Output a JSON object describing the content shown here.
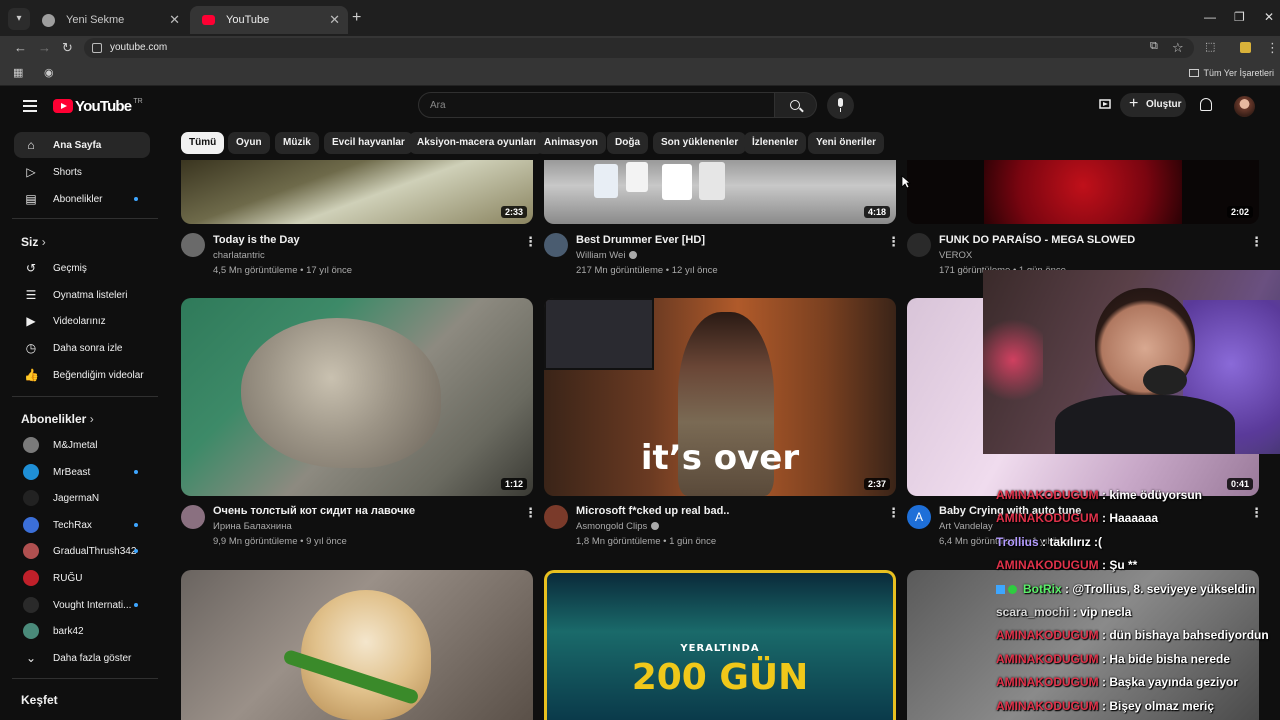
{
  "browser": {
    "tabs": [
      {
        "title": "Yeni Sekme"
      },
      {
        "title": "YouTube"
      }
    ],
    "url": "youtube.com",
    "bookmarks_folder": "Tüm Yer İşaretleri"
  },
  "header": {
    "logo_text": "YouTube",
    "country_code": "TR",
    "search_placeholder": "Ara",
    "create_label": "Oluştur"
  },
  "sidebar": {
    "main": [
      {
        "label": "Ana Sayfa",
        "icon": "home-icon",
        "active": true
      },
      {
        "label": "Shorts",
        "icon": "shorts-icon"
      },
      {
        "label": "Abonelikler",
        "icon": "subscriptions-icon",
        "dot": true
      }
    ],
    "you_header": "Siz",
    "you": [
      {
        "label": "Geçmiş",
        "icon": "history-icon"
      },
      {
        "label": "Oynatma listeleri",
        "icon": "playlists-icon"
      },
      {
        "label": "Videolarınız",
        "icon": "your-videos-icon"
      },
      {
        "label": "Daha sonra izle",
        "icon": "watch-later-icon"
      },
      {
        "label": "Beğendiğim videolar",
        "icon": "liked-videos-icon"
      }
    ],
    "subs_header": "Abonelikler",
    "subscriptions": [
      {
        "label": "M&Jmetal",
        "color": "#7a7a7a"
      },
      {
        "label": "MrBeast",
        "color": "#1f8fd6",
        "dot": true
      },
      {
        "label": "JagermaN",
        "color": "#222222"
      },
      {
        "label": "TechRax",
        "color": "#3b6fd8",
        "dot": true
      },
      {
        "label": "GradualThrush342",
        "color": "#b05050",
        "dot": true
      },
      {
        "label": "RUĞU",
        "color": "#c0202a"
      },
      {
        "label": "Vought Internati...",
        "color": "#2a2a2a",
        "dot": true
      },
      {
        "label": "bark42",
        "color": "#4a8a7a"
      }
    ],
    "show_more": "Daha fazla göster",
    "explore_header": "Keşfet"
  },
  "chips": [
    "Tümü",
    "Oyun",
    "Müzik",
    "Evcil hayvanlar",
    "Aksiyon-macera oyunları",
    "Animasyon",
    "Doğa",
    "Son yüklenenler",
    "İzlenenler",
    "Yeni öneriler"
  ],
  "videos": [
    {
      "title": "Today is the Day",
      "channel": "charlatantric",
      "meta": "4,5 Mn görüntüleme • 17 yıl önce",
      "duration": "2:33",
      "verified": false
    },
    {
      "title": "Best Drummer Ever [HD]",
      "channel": "William Wei",
      "meta": "217 Mn görüntüleme • 12 yıl önce",
      "duration": "4:18",
      "verified": true
    },
    {
      "title": "FUNK DO PARAÍSO - MEGA SLOWED",
      "channel": "VEROX",
      "meta": "171 görüntüleme • 1 gün önce",
      "duration": "2:02",
      "verified": false
    },
    {
      "title": "Очень толстый кот сидит на лавочке",
      "channel": "Ирина Балахнина",
      "meta": "9,9 Mn görüntüleme • 9 yıl önce",
      "duration": "1:12",
      "verified": false
    },
    {
      "title": "Microsoft f*cked up real bad..",
      "channel": "Asmongold Clips",
      "meta": "1,8 Mn görüntüleme • 1 gün önce",
      "duration": "2:37",
      "verified": true,
      "overlay": "it’s over"
    },
    {
      "title": "Baby Crying with auto tune",
      "channel": "Art Vandelay",
      "meta": "6,4 Mn görüntüleme • 1 yıl önce",
      "duration": "0:41",
      "verified": false,
      "avatar_letter": "A"
    },
    {
      "overlay_small": "YERALTINDA",
      "overlay_big": "200 GÜN"
    }
  ],
  "chat": [
    {
      "user": "AMINAKODUGUM",
      "msg": ": kime ödüyorsun",
      "style": ""
    },
    {
      "user": "AMINAKODUGUM",
      "msg": ": Haaaaaa",
      "style": ""
    },
    {
      "user": "Trollius",
      "msg": ": takılırız :(",
      "style": "purple"
    },
    {
      "user": "AMINAKODUGUM",
      "msg": ": Şu **",
      "style": ""
    },
    {
      "user": "BotRix",
      "msg": ": @Trollius, 8. seviyeye yükseldin",
      "style": "green"
    },
    {
      "user": "scara_mochi",
      "msg": ": vip necla",
      "style": "gray"
    },
    {
      "user": "AMINAKODUGUM",
      "msg": ": dün bishaya bahsediyordun",
      "style": ""
    },
    {
      "user": "AMINAKODUGUM",
      "msg": ": Ha bide bisha nerede",
      "style": ""
    },
    {
      "user": "AMINAKODUGUM",
      "msg": ": Başka yayında geziyor",
      "style": ""
    },
    {
      "user": "AMINAKODUGUM",
      "msg": ": Bişey olmaz meriç",
      "style": ""
    }
  ],
  "colors": {
    "brand_red": "#ff0033",
    "background": "#0f0f0f",
    "chip_bg": "#272727",
    "accent_blue": "#3ea6ff"
  }
}
